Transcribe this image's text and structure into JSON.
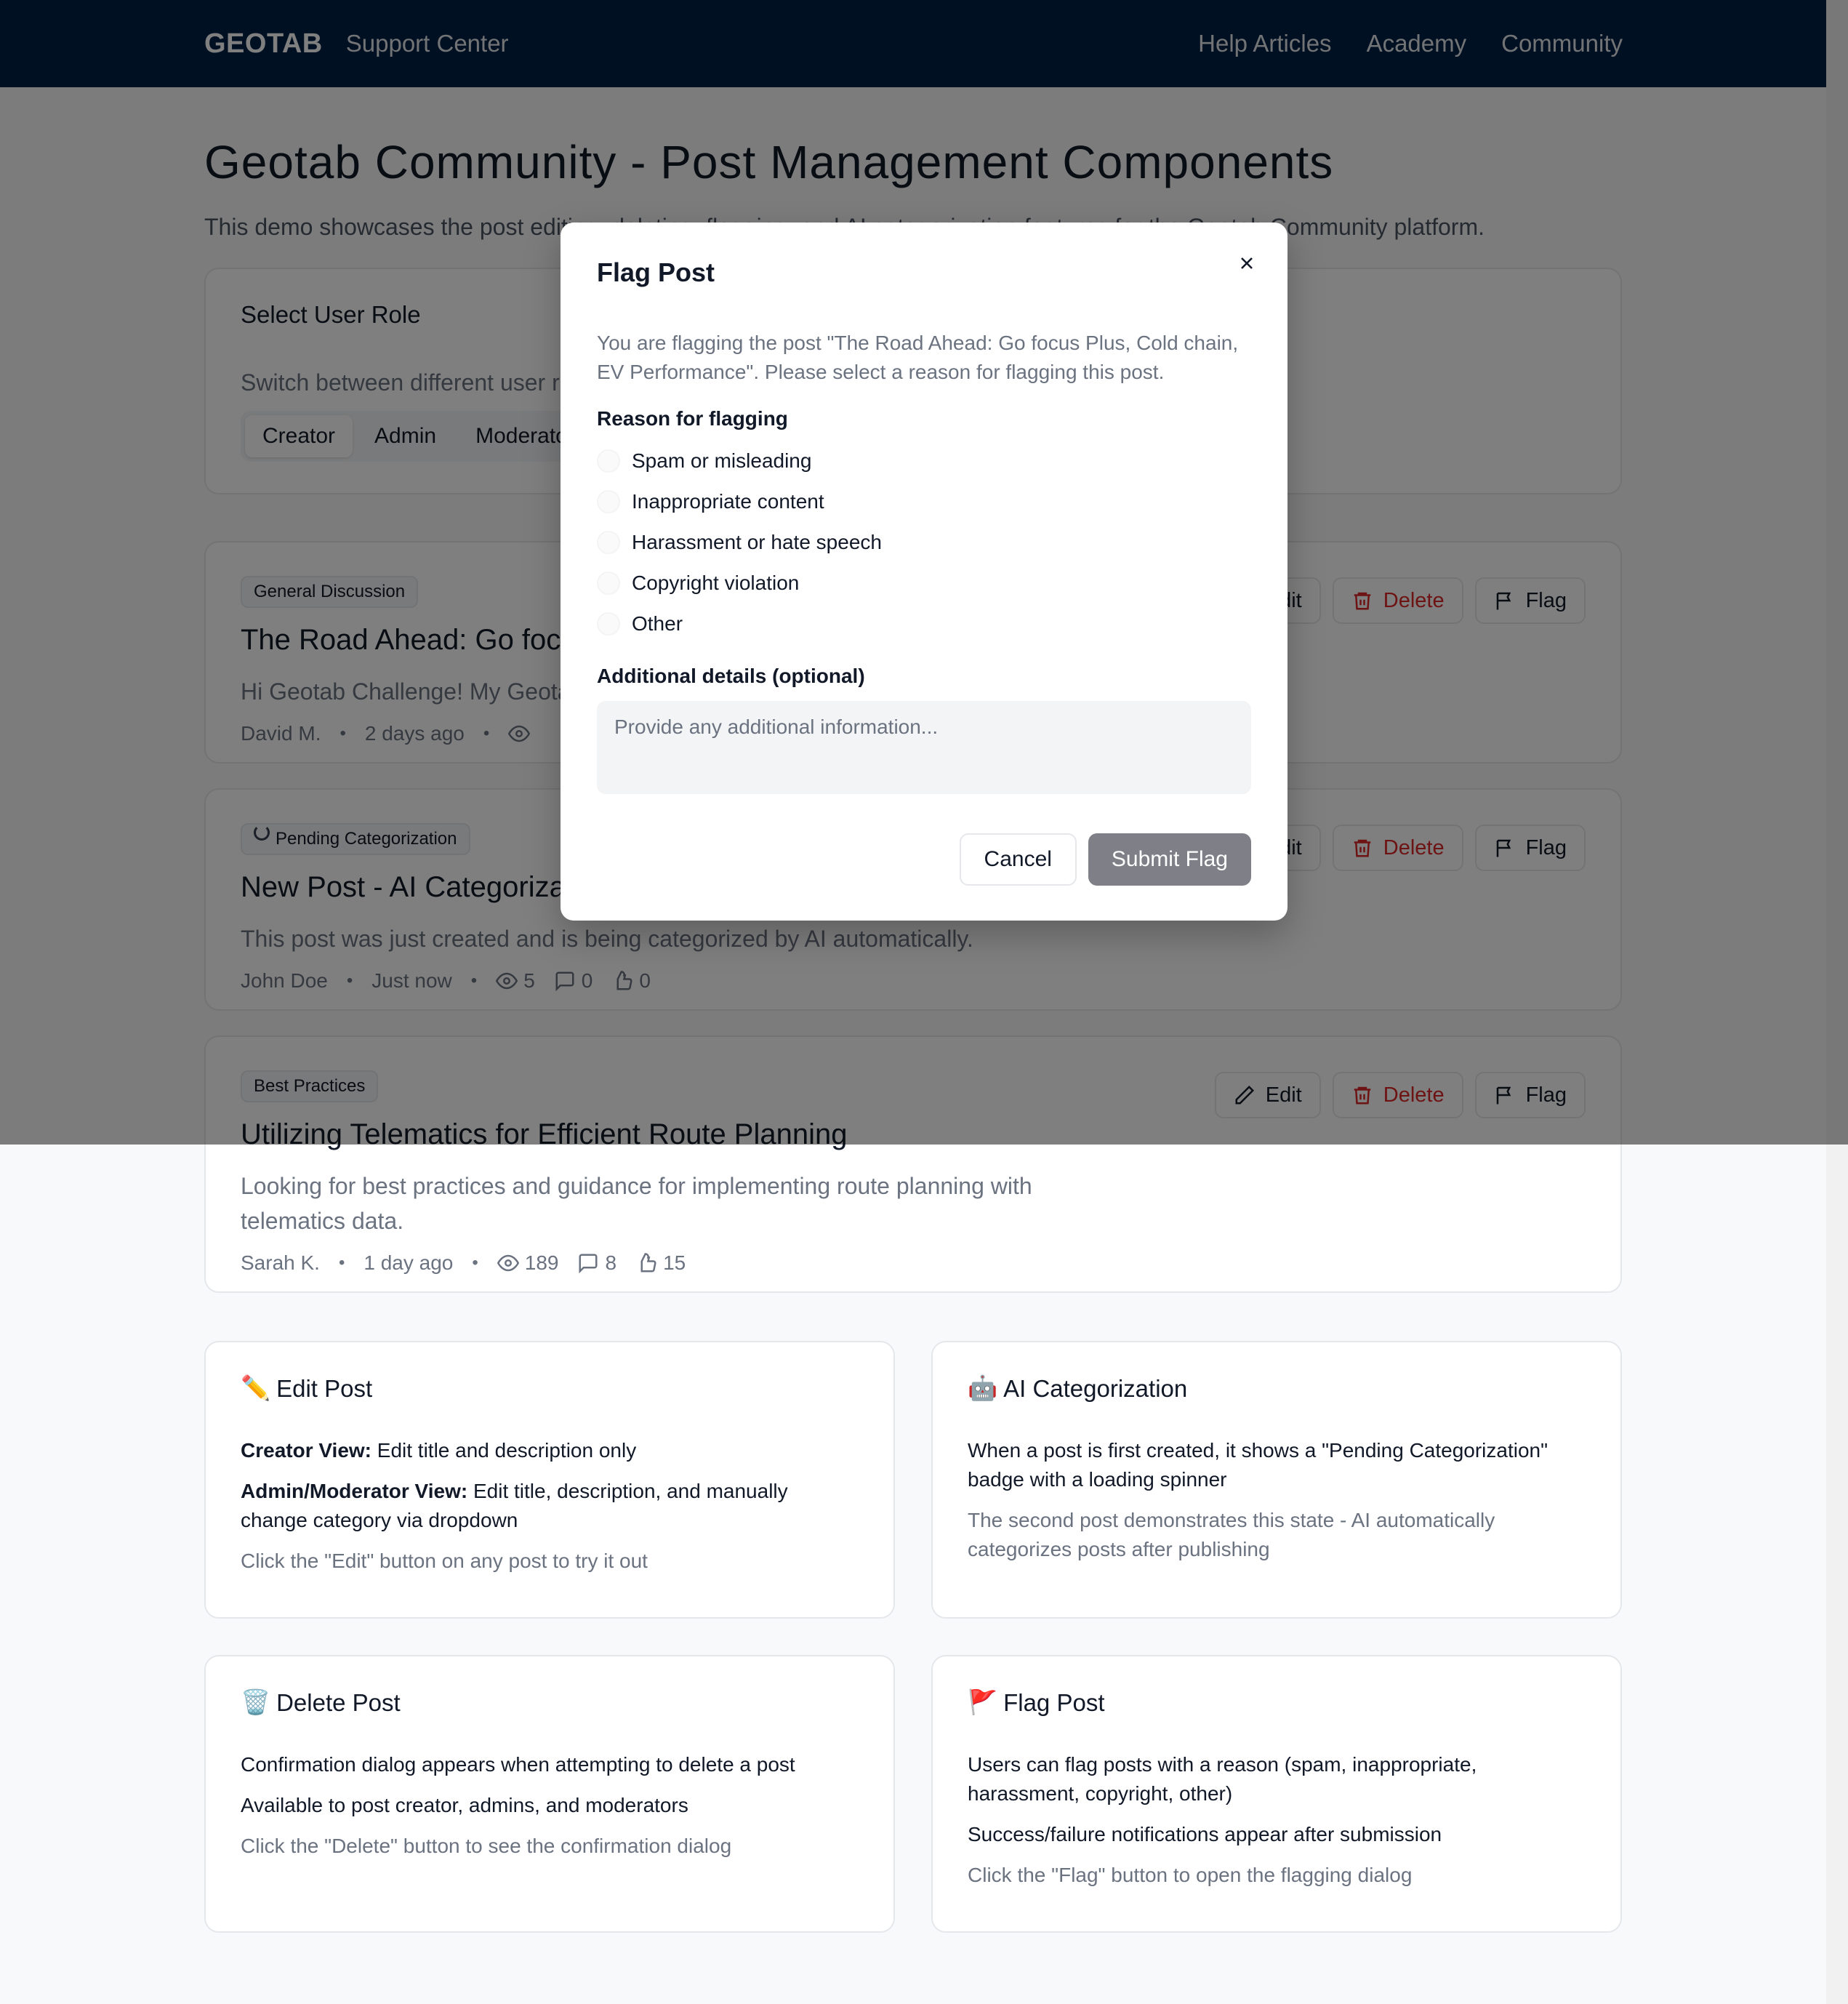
{
  "header": {
    "brand": "GEOTAB",
    "subtitle": "Support Center",
    "nav": [
      "Help Articles",
      "Academy",
      "Community"
    ]
  },
  "page": {
    "title": "Geotab Community - Post Management Components",
    "description": "This demo showcases the post editing, deleting, flagging, and AI categorization features for the Geotab Community platform."
  },
  "role_selector": {
    "title": "Select User Role",
    "description": "Switch between different user roles to see how permissions change",
    "roles": [
      "Creator",
      "Admin",
      "Moderator"
    ],
    "active": "Creator"
  },
  "actions": {
    "edit": "Edit",
    "delete": "Delete",
    "flag": "Flag"
  },
  "posts": [
    {
      "category": "General Discussion",
      "title": "The Road Ahead: Go focus Plus, Cold chain, EV Performance",
      "body": "Hi Geotab Challenge! My Geotab",
      "author": "David M.",
      "time": "2 days ago",
      "views": "",
      "comments": "",
      "likes": ""
    },
    {
      "category": "Pending Categorization",
      "title": "New Post - AI Categorization",
      "body": "This post was just created and is being categorized by AI automatically.",
      "author": "John Doe",
      "time": "Just now",
      "views": "5",
      "comments": "0",
      "likes": "0"
    },
    {
      "category": "Best Practices",
      "title": "Utilizing Telematics for Efficient Route Planning",
      "body": "Looking for best practices and guidance for implementing route planning with telematics data.",
      "author": "Sarah K.",
      "time": "1 day ago",
      "views": "189",
      "comments": "8",
      "likes": "15"
    }
  ],
  "info_cards": {
    "edit": {
      "icon": "✏️",
      "title": "Edit Post",
      "creator_label": "Creator View:",
      "creator_text": "Edit title and description only",
      "admin_label": "Admin/Moderator View:",
      "admin_text": "Edit title, description, and manually change category via dropdown",
      "hint": "Click the \"Edit\" button on any post to try it out"
    },
    "ai": {
      "icon": "🤖",
      "title": "AI Categorization",
      "line1": "When a post is first created, it shows a \"Pending Categorization\" badge with a loading spinner",
      "hint": "The second post demonstrates this state - AI automatically categorizes posts after publishing"
    },
    "delete": {
      "icon": "🗑️",
      "title": "Delete Post",
      "line1": "Confirmation dialog appears when attempting to delete a post",
      "line2": "Available to post creator, admins, and moderators",
      "hint": "Click the \"Delete\" button to see the confirmation dialog"
    },
    "flag": {
      "icon": "🚩",
      "title": "Flag Post",
      "line1": "Users can flag posts with a reason (spam, inappropriate, harassment, copyright, other)",
      "line2": "Success/failure notifications appear after submission",
      "hint": "Click the \"Flag\" button to open the flagging dialog"
    }
  },
  "modal": {
    "title": "Flag Post",
    "description": "You are flagging the post \"The Road Ahead: Go focus Plus, Cold chain, EV Performance\". Please select a reason for flagging this post.",
    "reason_label": "Reason for flagging",
    "reasons": [
      "Spam or misleading",
      "Inappropriate content",
      "Harassment or hate speech",
      "Copyright violation",
      "Other"
    ],
    "details_label": "Additional details (optional)",
    "details_placeholder": "Provide any additional information...",
    "details_value": "",
    "cancel": "Cancel",
    "submit": "Submit Flag"
  },
  "colors": {
    "header_bg": "#002147",
    "danger": "#dc2626",
    "submit_disabled": "#7f7f87"
  }
}
